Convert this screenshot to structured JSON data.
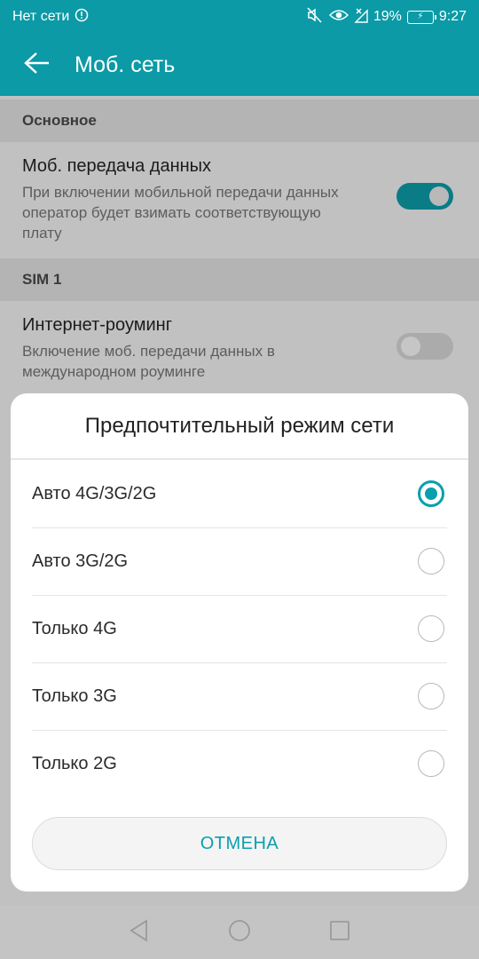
{
  "status_bar": {
    "network_text": "Нет сети",
    "battery_percent": "19%",
    "time": "9:27"
  },
  "app_bar": {
    "title": "Моб. сеть"
  },
  "settings": {
    "section_main": "Основное",
    "mobile_data": {
      "title": "Моб. передача данных",
      "subtitle": "При включении мобильной передачи данных оператор будет взимать соответствующую плату",
      "enabled": true
    },
    "section_sim": "SIM 1",
    "roaming": {
      "title": "Интернет-роуминг",
      "subtitle": "Включение моб. передачи данных в международном роуминге",
      "enabled": false
    }
  },
  "dialog": {
    "title": "Предпочтительный режим сети",
    "options": [
      {
        "label": "Авто 4G/3G/2G",
        "selected": true
      },
      {
        "label": "Авто 3G/2G",
        "selected": false
      },
      {
        "label": "Только 4G",
        "selected": false
      },
      {
        "label": "Только 3G",
        "selected": false
      },
      {
        "label": "Только 2G",
        "selected": false
      }
    ],
    "cancel_label": "ОТМЕНА"
  },
  "colors": {
    "accent": "#0a9fac",
    "app_bar": "#0b9aa6"
  },
  "icons": {
    "status_left": "alert-circle-icon",
    "status_right": [
      "mute-icon",
      "eye-icon",
      "no-signal-icon",
      "battery-icon"
    ],
    "app_bar": "arrow-back-icon",
    "nav": [
      "nav-back-icon",
      "nav-home-icon",
      "nav-recents-icon"
    ]
  }
}
